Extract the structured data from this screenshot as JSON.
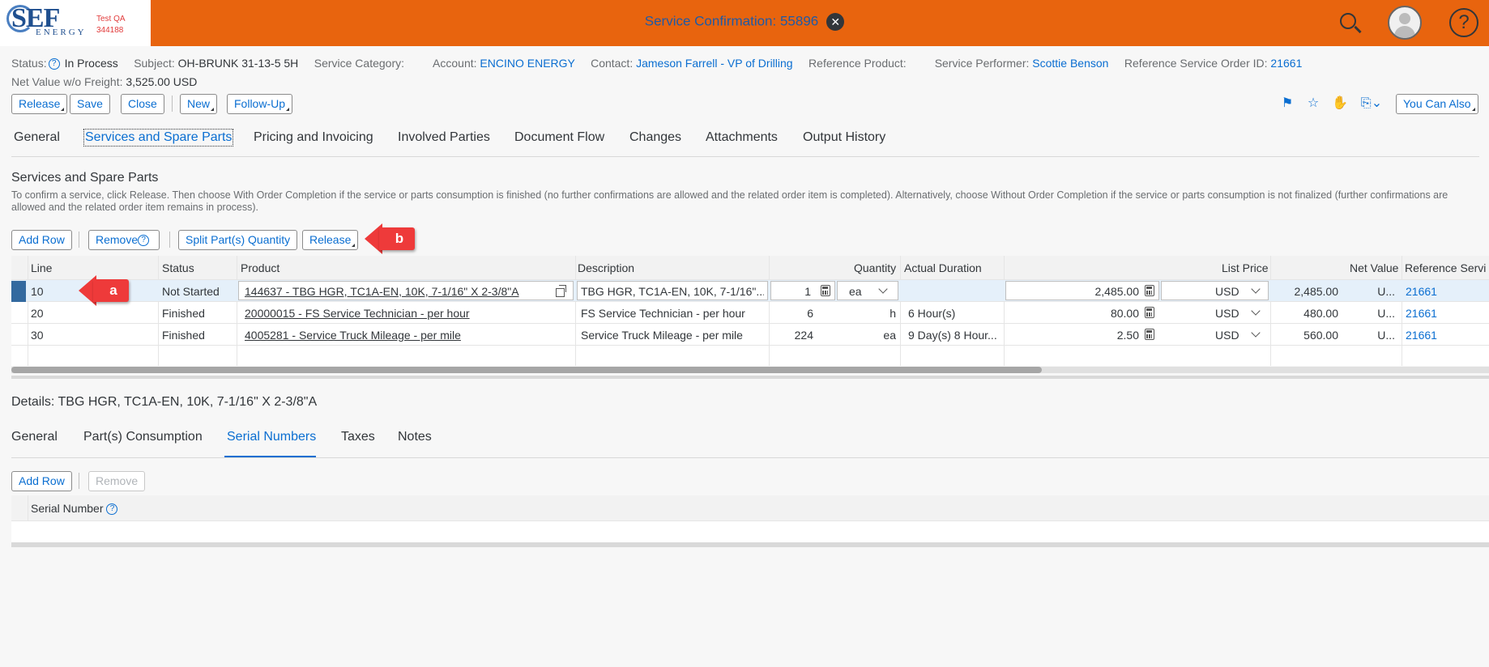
{
  "brand": {
    "logo_text": "SEF",
    "logo_sub": "ENERGY",
    "env_line1": "Test QA",
    "env_line2": "344188"
  },
  "shell": {
    "title": "Service Confirmation: 55896"
  },
  "header": {
    "status_label": "Status:",
    "status_value": "In Process",
    "subject_label": "Subject:",
    "subject_value": "OH-BRUNK 31-13-5 5H",
    "category_label": "Service Category:",
    "account_label": "Account:",
    "account_value": "ENCINO ENERGY",
    "contact_label": "Contact:",
    "contact_value": "Jameson Farrell - VP of Drilling",
    "ref_product_label": "Reference Product:",
    "performer_label": "Service Performer:",
    "performer_value": "Scottie Benson",
    "ref_order_label": "Reference Service Order ID:",
    "ref_order_value": "21661",
    "net_value_label": "Net Value w/o Freight:",
    "net_value": "3,525.00 USD"
  },
  "toolbar": {
    "release": "Release",
    "save": "Save",
    "close": "Close",
    "new": "New",
    "follow_up": "Follow-Up",
    "you_can_also": "You Can Also"
  },
  "tabs": [
    "General",
    "Services and Spare Parts",
    "Pricing and Invoicing",
    "Involved Parties",
    "Document Flow",
    "Changes",
    "Attachments",
    "Output History"
  ],
  "section": {
    "title": "Services and Spare Parts",
    "description": "To confirm a service, click Release. Then choose With Order Completion if the service or parts consumption is finished (no further confirmations are allowed and the related order item is completed). Alternatively, choose Without Order Completion if the service or parts consumption is not finalized (further confirmations are allowed and the related order item remains in process)."
  },
  "table_toolbar": {
    "add_row": "Add Row",
    "remove": "Remove",
    "split": "Split Part(s) Quantity",
    "release": "Release"
  },
  "table": {
    "columns": [
      "Line",
      "Status",
      "Product",
      "Description",
      "Quantity",
      "Actual Duration",
      "List Price",
      "Net Value",
      "Reference Servi"
    ],
    "rows": [
      {
        "line": "10",
        "status": "Not Started",
        "product": "144637 - TBG HGR, TC1A-EN, 10K, 7-1/16\" X 2-3/8\"A",
        "description": "TBG HGR, TC1A-EN, 10K, 7-1/16\"...",
        "qty": "1",
        "unit": "ea",
        "duration": "",
        "price": "2,485.00",
        "currency": "USD",
        "net": "2,485.00",
        "net_cur": "U...",
        "ref": "21661"
      },
      {
        "line": "20",
        "status": "Finished",
        "product": "20000015 - FS Service Technician - per hour",
        "description": "FS Service Technician - per hour",
        "qty": "6",
        "unit": "h",
        "duration": "6 Hour(s)",
        "price": "80.00",
        "currency": "USD",
        "net": "480.00",
        "net_cur": "U...",
        "ref": "21661"
      },
      {
        "line": "30",
        "status": "Finished",
        "product": "4005281 - Service Truck Mileage - per mile",
        "description": "Service Truck Mileage - per mile",
        "qty": "224",
        "unit": "ea",
        "duration": "9 Day(s) 8 Hour...",
        "price": "2.50",
        "currency": "USD",
        "net": "560.00",
        "net_cur": "U...",
        "ref": "21661"
      }
    ]
  },
  "details": {
    "title": "Details: TBG HGR, TC1A-EN, 10K, 7-1/16\" X 2-3/8\"A",
    "tabs": [
      "General",
      "Part(s) Consumption",
      "Serial Numbers",
      "Taxes",
      "Notes"
    ],
    "add_row": "Add Row",
    "remove": "Remove",
    "serial_col": "Serial Number"
  },
  "callouts": {
    "a": "a",
    "b": "b"
  }
}
